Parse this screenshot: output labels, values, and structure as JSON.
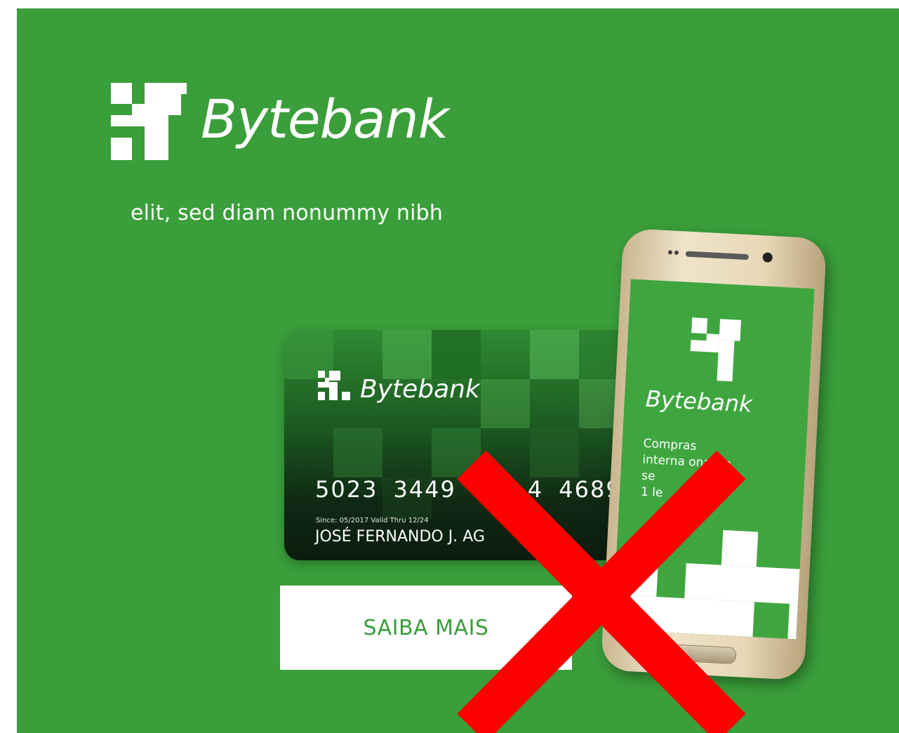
{
  "brand": {
    "name": "Bytebank",
    "tagline": "elit, sed diam nonummy nibh"
  },
  "card": {
    "brand": "Bytebank",
    "number_groups": [
      "5023",
      "3449",
      "",
      "4689"
    ],
    "number_group_3_partial": "4",
    "dates": "Since: 05/2017  Valid Thru 12/24",
    "holder": "JOSÉ FERNANDO J. AG"
  },
  "cta": {
    "label": "SAIBA MAIS"
  },
  "phone": {
    "brand": "Bytebank",
    "copy_line1": "Compras",
    "copy_line2": "interna  onais a",
    "copy_line3": "se",
    "copy_line4": "1          le"
  },
  "colors": {
    "banner": "#3a9e3a",
    "cta_text": "#3a9e3a",
    "overlay_x": "#ff0000"
  },
  "icons": {
    "logo": "bytebank-pixel-logo",
    "overlay": "red-x-cross"
  }
}
